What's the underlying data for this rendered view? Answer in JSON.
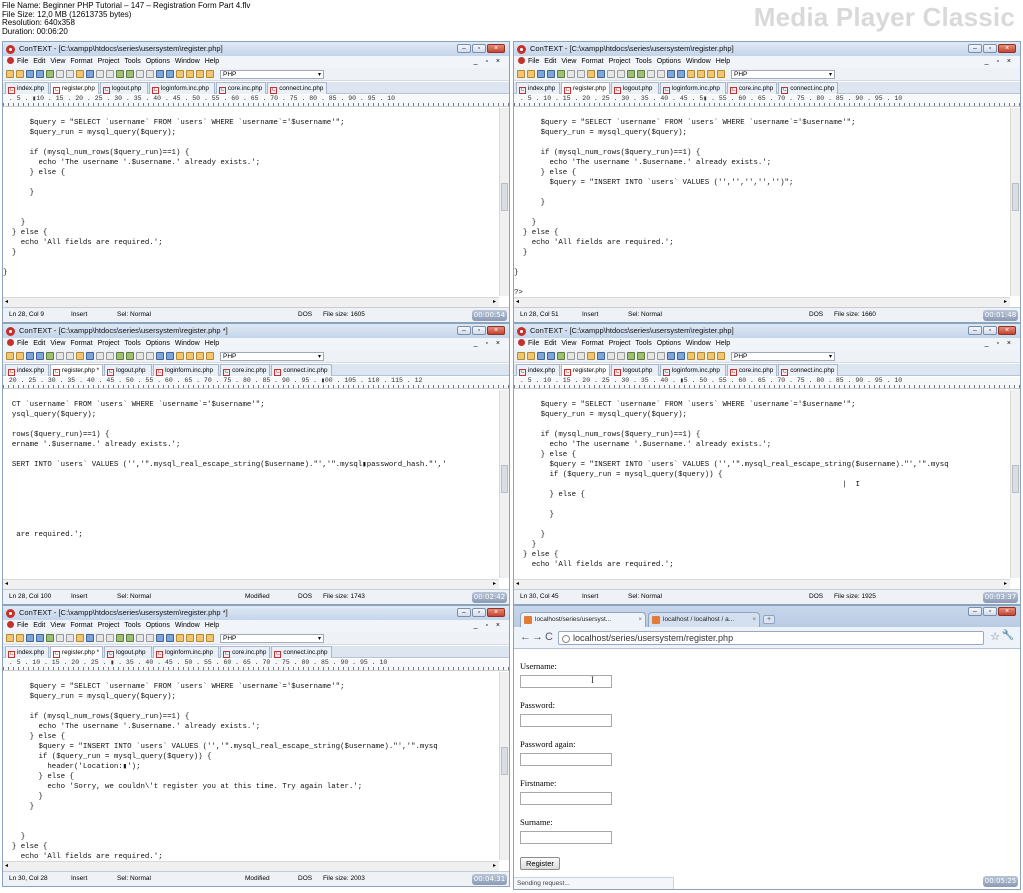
{
  "file_info": {
    "name": "File Name: Beginner PHP Tutorial – 147 – Registration Form Part 4.flv",
    "size": "File Size: 12,0 MB (12613735 bytes)",
    "resolution": "Resolution: 640x358",
    "duration": "Duration: 00:06:20"
  },
  "brand": "Media Player Classic",
  "editor": {
    "menu": [
      "File",
      "Edit",
      "View",
      "Format",
      "Project",
      "Tools",
      "Options",
      "Window",
      "Help"
    ],
    "mdi_controls": "_ ▫ ×",
    "language": "PHP",
    "tabs": [
      "index.php",
      "register.php",
      "logout.php",
      "loginform.inc.php",
      "core.inc.php",
      "connect.inc.php"
    ],
    "tab_icon": "C"
  },
  "panels": [
    {
      "title": "ConTEXT - [C:\\xampp\\htdocs\\series\\usersystem\\register.php]",
      "active_tab": "register.php",
      "ruler": " . 5 . ▮10 . 15 . 20 . 25 . 30 . 35 . 40 . 45 . 50 . 55 . 60 . 65 . 70 . 75 . 80 . 85 . 90 . 95 . 10",
      "code": [
        "",
        "      $query = \"SELECT `username` FROM `users` WHERE `username`='$username'\";",
        "      $query_run = mysql_query($query);",
        "",
        "      if (mysql_num_rows($query_run)==1) {",
        "        echo 'The username '.$username.' already exists.';",
        "      } else {",
        "",
        "      }",
        "",
        "",
        "    }",
        "  } else {",
        "    echo 'All fields are required.';",
        "  }",
        "",
        "}",
        "",
        "",
        "?>"
      ],
      "status": {
        "pos": "Ln 28, Col 9",
        "mode": "Insert",
        "sel": "Sel: Normal",
        "modified": "",
        "format": "DOS",
        "size": "File size: 1605"
      },
      "time": "00:00:54"
    },
    {
      "title": "ConTEXT - [C:\\xampp\\htdocs\\series\\usersystem\\register.php]",
      "active_tab": "register.php",
      "ruler": " . 5 . 10 . 15 . 20 . 25 . 30 . 35 . 40 . 45 . 5▮ . 55 . 60 . 65 . 70 . 75 . 80 . 85 . 90 . 95 . 10",
      "code": [
        "",
        "      $query = \"SELECT `username` FROM `users` WHERE `username`='$username'\";",
        "      $query_run = mysql_query($query);",
        "",
        "      if (mysql_num_rows($query_run)==1) {",
        "        echo 'The username '.$username.' already exists.';",
        "      } else {",
        "        $query = \"INSERT INTO `users` VALUES ('','','','','')\";",
        "",
        "      }",
        "",
        "    }",
        "  } else {",
        "    echo 'All fields are required.';",
        "  }",
        "",
        "}",
        "",
        "?>"
      ],
      "status": {
        "pos": "Ln 28, Col 51",
        "mode": "Insert",
        "sel": "Sel: Normal",
        "modified": "",
        "format": "DOS",
        "size": "File size: 1660"
      },
      "time": "00:01:48"
    },
    {
      "title": "ConTEXT - [C:\\xampp\\htdocs\\series\\usersystem\\register.php *]",
      "active_tab": "register.php *",
      "ruler": " 20 . 25 . 30 . 35 . 40 . 45 . 50 . 55 . 60 . 65 . 70 . 75 . 80 . 85 . 90 . 95 . ▮00 . 105 . 110 . 115 . 12",
      "code": [
        "",
        "  CT `username` FROM `users` WHERE `username`='$username'\";",
        "  ysql_query($query);",
        "",
        "  rows($query_run)==1) {",
        "  ername '.$username.' already exists.';",
        "",
        "  SERT INTO `users` VALUES ('','\".mysql_real_escape_string($username).\"','\".mysql▮password_hash.\"','",
        "",
        "",
        "",
        "",
        "",
        "",
        "   are required.';",
        "",
        "",
        ""
      ],
      "status": {
        "pos": "Ln 28, Col 100",
        "mode": "Insert",
        "sel": "Sel: Normal",
        "modified": "Modified",
        "format": "DOS",
        "size": "File size: 1743"
      },
      "time": "00:02:42"
    },
    {
      "title": "ConTEXT - [C:\\xampp\\htdocs\\series\\usersystem\\register.php]",
      "active_tab": "register.php",
      "ruler": " . 5 . 10 . 15 . 20 . 25 . 30 . 35 . 40 . ▮5 . 50 . 55 . 60 . 65 . 70 . 75 . 80 . 85 . 90 . 95 . 10",
      "code": [
        "",
        "      $query = \"SELECT `username` FROM `users` WHERE `username`='$username'\";",
        "      $query_run = mysql_query($query);",
        "",
        "      if (mysql_num_rows($query_run)==1) {",
        "        echo 'The username '.$username.' already exists.';",
        "      } else {",
        "        $query = \"INSERT INTO `users` VALUES ('','\".mysql_real_escape_string($username).\"','\".mysq",
        "        if ($query_run = mysql_query($query)) {",
        "                                                                          |  I",
        "        } else {",
        "",
        "        }",
        "",
        "      }",
        "    }",
        "  } else {",
        "    echo 'All fields are required.';"
      ],
      "status": {
        "pos": "Ln 30, Col 45",
        "mode": "Insert",
        "sel": "Sel: Normal",
        "modified": "",
        "format": "DOS",
        "size": "File size: 1925"
      },
      "time": "00:03:37"
    },
    {
      "title": "ConTEXT - [C:\\xampp\\htdocs\\series\\usersystem\\register.php *]",
      "active_tab": "register.php *",
      "ruler": " . 5 . 10 . 15 . 20 . 25 . ▮ . 35 . 40 . 45 . 50 . 55 . 60 . 65 . 70 . 75 . 80 . 85 . 90 . 95 . 10",
      "code": [
        "",
        "      $query = \"SELECT `username` FROM `users` WHERE `username`='$username'\";",
        "      $query_run = mysql_query($query);",
        "",
        "      if (mysql_num_rows($query_run)==1) {",
        "        echo 'The username '.$username.' already exists.';",
        "      } else {",
        "        $query = \"INSERT INTO `users` VALUES ('','\".mysql_real_escape_string($username).\"','\".mysq",
        "        if ($query_run = mysql_query($query)) {",
        "          header('Location:▮');",
        "        } else {",
        "          echo 'Sorry, we couldn\\'t register you at this time. Try again later.';",
        "        }",
        "      }",
        "",
        "",
        "    }",
        "  } else {",
        "    echo 'All fields are required.';"
      ],
      "status": {
        "pos": "Ln 30, Col 28",
        "mode": "Insert",
        "sel": "Sel: Normal",
        "modified": "Modified",
        "format": "DOS",
        "size": "File size: 2003"
      },
      "time": "00:04:31"
    }
  ],
  "browser": {
    "tabs": [
      {
        "label": "localhost/series/usersyst...",
        "close": "×"
      },
      {
        "label": "localhost / localhost / a...",
        "close": "×"
      }
    ],
    "new_tab": "+",
    "url": "localhost/series/usersystem/register.php",
    "form_labels": [
      "Username:",
      "Password:",
      "Password again:",
      "Firstname:",
      "Surname:"
    ],
    "button": "Register",
    "status": "Sending request...",
    "time": "00:05:25",
    "window_controls": [
      "–",
      "▫",
      "×"
    ]
  }
}
